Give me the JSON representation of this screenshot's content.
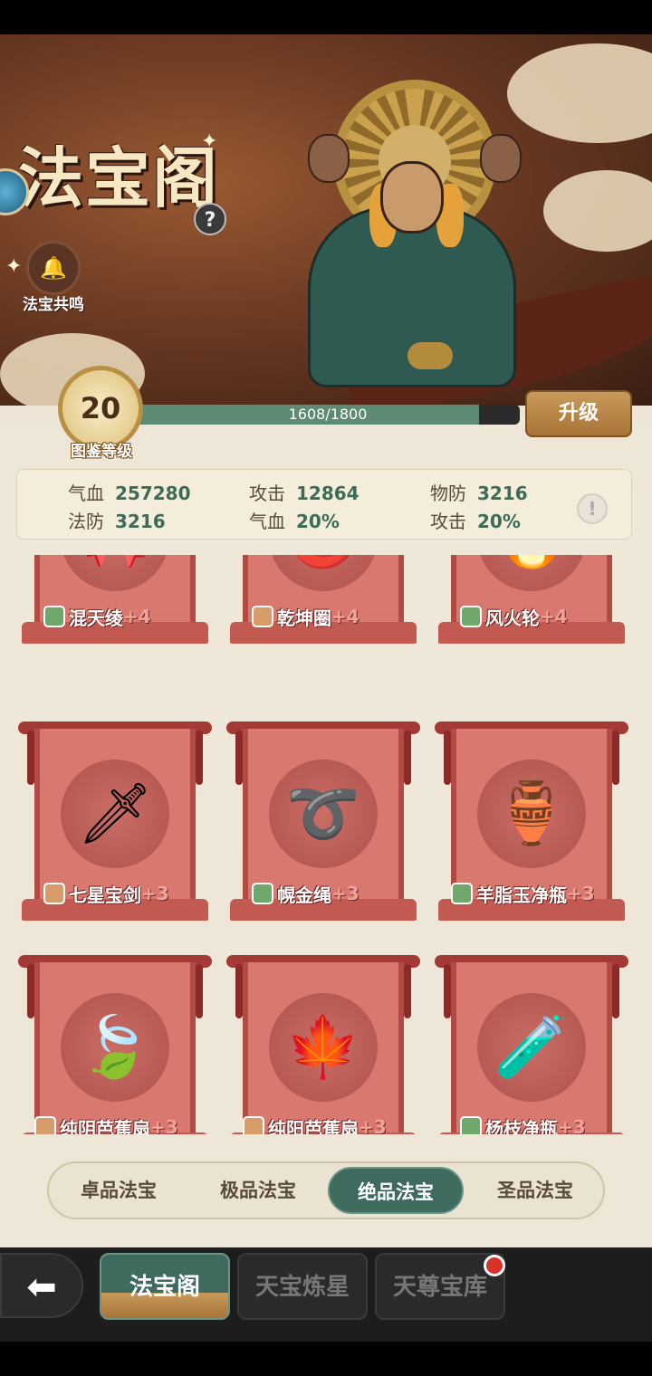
{
  "header": {
    "title": "法宝阁",
    "help_label": "?",
    "resonance_label": "法宝共鸣"
  },
  "level": {
    "value": "20",
    "label": "图鉴等级",
    "exp_text": "1608/1800",
    "exp_fraction": 0.893,
    "upgrade_label": "升级"
  },
  "stats": [
    {
      "key": "气血",
      "value": "257280"
    },
    {
      "key": "攻击",
      "value": "12864"
    },
    {
      "key": "物防",
      "value": "3216"
    },
    {
      "key": "法防",
      "value": "3216"
    },
    {
      "key": "气血",
      "value": "20%"
    },
    {
      "key": "攻击",
      "value": "20%"
    }
  ],
  "info_label": "!",
  "cards": [
    {
      "name": "混天绫",
      "level": "+4",
      "tag": "green",
      "icon": "sash-icon"
    },
    {
      "name": "乾坤圈",
      "level": "+4",
      "tag": "orange",
      "icon": "ring-icon"
    },
    {
      "name": "风火轮",
      "level": "+4",
      "tag": "green",
      "icon": "wheel-icon"
    },
    {
      "name": "七星宝剑",
      "level": "+3",
      "tag": "orange",
      "icon": "sword-icon"
    },
    {
      "name": "幌金绳",
      "level": "+3",
      "tag": "green",
      "icon": "rope-icon"
    },
    {
      "name": "羊脂玉净瓶",
      "level": "+3",
      "tag": "green",
      "icon": "vase-icon"
    },
    {
      "name": "纯阴芭蕉扇",
      "level": "+3",
      "tag": "orange",
      "icon": "green-fan-icon"
    },
    {
      "name": "纯阳芭蕉扇",
      "level": "+3",
      "tag": "orange",
      "icon": "red-fan-icon"
    },
    {
      "name": "杨枝净瓶",
      "level": "+3",
      "tag": "green",
      "icon": "bottle-icon"
    }
  ],
  "tabs": [
    {
      "label": "卓品法宝",
      "active": false
    },
    {
      "label": "极品法宝",
      "active": false
    },
    {
      "label": "绝品法宝",
      "active": true
    },
    {
      "label": "圣品法宝",
      "active": false
    }
  ],
  "nav": {
    "back_icon": "back-arrow-icon",
    "items": [
      {
        "label": "法宝阁",
        "active": true
      },
      {
        "label": "天宝炼星",
        "active": false
      },
      {
        "label": "天尊宝库",
        "active": false,
        "badge": true
      }
    ]
  },
  "colors": {
    "accent": "#3f6a5e",
    "card": "#d9786e",
    "gold": "#c89a5a"
  }
}
